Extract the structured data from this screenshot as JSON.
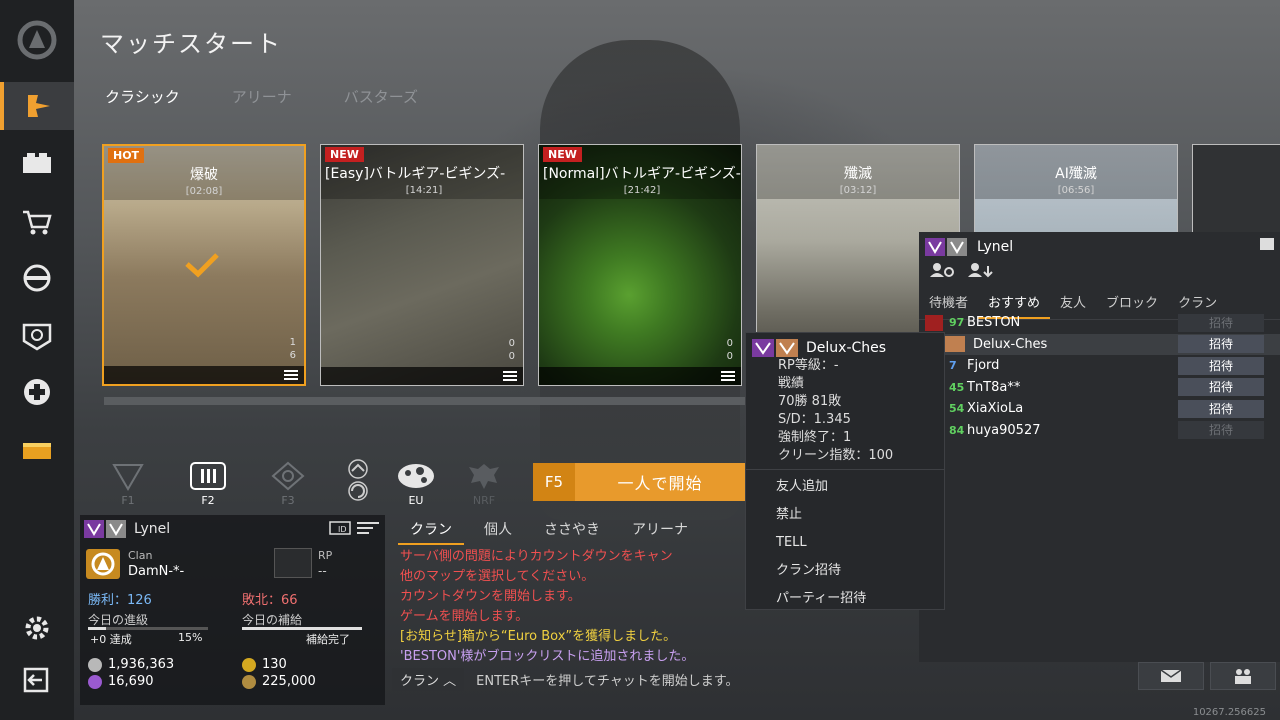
{
  "header": {
    "title": "マッチスタート"
  },
  "mode_tabs": [
    {
      "label": "クラシック",
      "active": true
    },
    {
      "label": "アリーナ",
      "active": false
    },
    {
      "label": "バスターズ",
      "active": false
    }
  ],
  "maps": [
    {
      "badge": "HOT",
      "name": "爆破",
      "time": "[02:08]",
      "count1": "1",
      "count2": "6"
    },
    {
      "badge": "NEW",
      "name": "[Easy]バトルギア-ビギンズ-",
      "time": "[14:21]",
      "count1": "0",
      "count2": "0"
    },
    {
      "badge": "NEW",
      "name": "[Normal]バトルギア-ビギンズ-",
      "time": "[21:42]",
      "count1": "0",
      "count2": "0"
    },
    {
      "badge": "",
      "name": "殲滅",
      "time": "[03:12]"
    },
    {
      "badge": "",
      "name": "AI殲滅",
      "time": "[06:56]"
    }
  ],
  "filters": [
    {
      "label": "F1"
    },
    {
      "label": "F2"
    },
    {
      "label": "F3"
    },
    {
      "label": ""
    },
    {
      "label": "EU"
    },
    {
      "label": "NRF"
    }
  ],
  "start": {
    "key": "F5",
    "label": "一人で開始"
  },
  "player": {
    "name": "Lynel",
    "clan_label": "Clan",
    "clan": "DamN-*-",
    "rp_label": "RP",
    "rp": "--",
    "wins": "勝利：126",
    "losses": "敗北：66",
    "progress_label": "今日の進級",
    "supply_label": "今日の補給",
    "progress_text": "+0 達成",
    "progress_pct": "15%",
    "progress_value": 0.15,
    "supply_text": "補給完了",
    "supply_value": 1.0,
    "currency1": "1,936,363",
    "currency2": "130",
    "currency3": "16,690",
    "currency4": "225,000"
  },
  "chat": {
    "tabs": [
      "クラン",
      "個人",
      "ささやき",
      "アリーナ"
    ],
    "messages": [
      "サーバ側の問題によりカウントダウンをキャン",
      "他のマップを選択してください。",
      "カウントダウンを開始します。",
      "ゲームを開始します。",
      "[お知らせ]箱から“Euro Box”を獲得しました。",
      "'BESTON'様がブロックリストに追加されました。"
    ],
    "channel": "クラン",
    "hint": "ENTERキーを押してチャットを開始します。"
  },
  "context_menu": {
    "name": "Delux-Ches",
    "stats": [
      "RP等級：-",
      "戦績",
      "70勝 81敗",
      "S/D：1.345",
      "強制終了：1",
      "クリーン指数：100"
    ],
    "items": [
      "友人追加",
      "禁止",
      "TELL",
      "クラン招待",
      "パーティー招待"
    ]
  },
  "friends_panel": {
    "name": "Lynel",
    "tabs": [
      "待機者",
      "おすすめ",
      "友人",
      "ブロック",
      "クラン"
    ],
    "rows": [
      {
        "level": "97",
        "name": "BESTON",
        "invite": "招待",
        "enabled": false
      },
      {
        "level": "",
        "name": "Delux-Ches",
        "invite": "招待",
        "enabled": true
      },
      {
        "level": "7",
        "name": "Fjord",
        "invite": "招待",
        "enabled": true
      },
      {
        "level": "45",
        "name": "TnT8a**",
        "invite": "招待",
        "enabled": true
      },
      {
        "level": "54",
        "name": "XiaXioLa",
        "invite": "招待",
        "enabled": true
      },
      {
        "level": "84",
        "name": "huya90527",
        "invite": "招待",
        "enabled": false
      }
    ]
  },
  "version": "10267.256625",
  "colors": {
    "accent": "#f0a020",
    "start": "#e89a2c",
    "hot": "#e07010",
    "new": "#c42020"
  }
}
